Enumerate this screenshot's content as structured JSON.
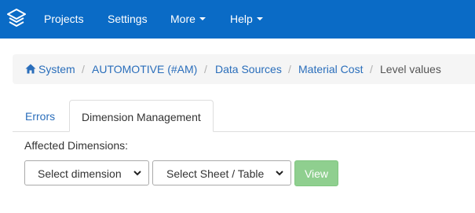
{
  "navbar": {
    "background": "#0a6bc6",
    "logo_icon": "stacked-layers-icon",
    "items": [
      {
        "label": "Projects",
        "dropdown": false
      },
      {
        "label": "Settings",
        "dropdown": false
      },
      {
        "label": "More",
        "dropdown": true
      },
      {
        "label": "Help",
        "dropdown": true
      }
    ]
  },
  "breadcrumb": {
    "home_icon": "home-icon",
    "items": [
      {
        "label": "System",
        "link": true
      },
      {
        "label": "AUTOMOTIVE (#AM)",
        "link": true
      },
      {
        "label": "Data Sources",
        "link": true
      },
      {
        "label": "Material Cost",
        "link": true
      },
      {
        "label": "Level values",
        "link": false
      }
    ],
    "separator": "/"
  },
  "tabs": {
    "items": [
      {
        "label": "Errors",
        "active": false
      },
      {
        "label": "Dimension Management",
        "active": true
      }
    ]
  },
  "form": {
    "affected_label": "Affected Dimensions:",
    "dimension_select": {
      "value": "Select dimension"
    },
    "sheet_select": {
      "value": "Select Sheet / Table"
    },
    "view_button": {
      "label": "View",
      "disabled": true,
      "color": "#8fcf8f"
    }
  },
  "colors": {
    "link": "#2a6ebb",
    "text": "#333333"
  }
}
